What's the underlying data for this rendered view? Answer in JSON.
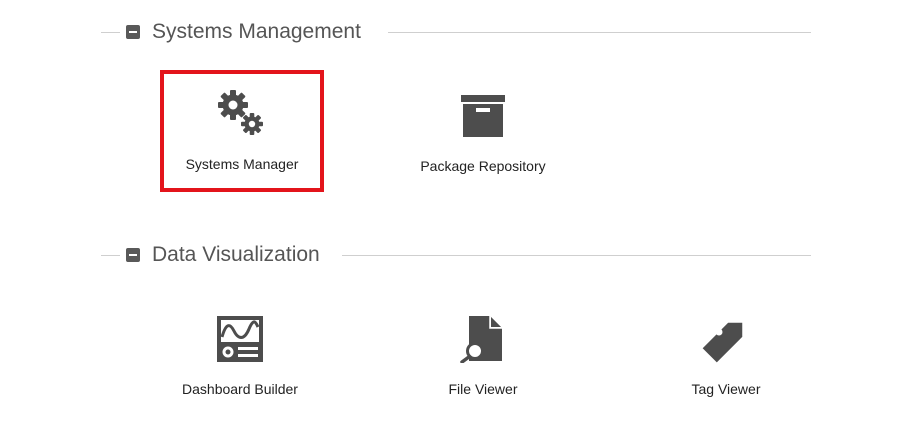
{
  "colors": {
    "icon": "#4d4d4d",
    "header_text": "#555555",
    "rule": "#cfcfcf",
    "selection_border": "#e3141b"
  },
  "sections": [
    {
      "title": "Systems Management",
      "toggle_icon": "minus-square-icon",
      "items": [
        {
          "label": "Systems Manager",
          "icon": "gears-icon",
          "selected": true
        },
        {
          "label": "Package Repository",
          "icon": "archive-box-icon",
          "selected": false
        }
      ]
    },
    {
      "title": "Data Visualization",
      "toggle_icon": "minus-square-icon",
      "items": [
        {
          "label": "Dashboard Builder",
          "icon": "dashboard-icon",
          "selected": false
        },
        {
          "label": "File Viewer",
          "icon": "file-search-icon",
          "selected": false
        },
        {
          "label": "Tag Viewer",
          "icon": "tag-icon",
          "selected": false
        }
      ]
    }
  ]
}
